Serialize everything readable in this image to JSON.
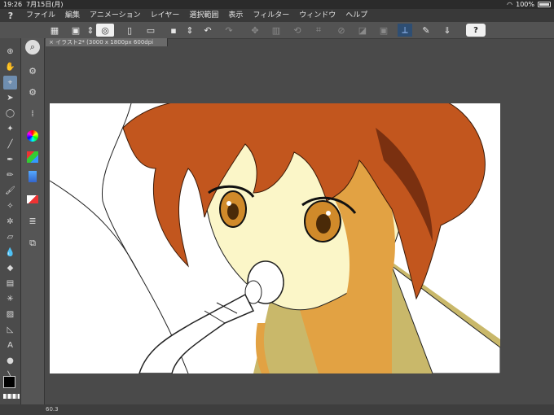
{
  "status_bar": {
    "time": "19:26",
    "date": "7月15日(月)",
    "battery": "100%"
  },
  "menu": {
    "items": [
      "ファイル",
      "編集",
      "アニメーション",
      "レイヤー",
      "選択範囲",
      "表示",
      "フィルター",
      "ウィンドウ",
      "ヘルプ"
    ]
  },
  "document": {
    "tab_title": "イラスト2* (3000 x 1800px 600dpi 60.3%)"
  },
  "statusbar_bottom": {
    "zoom": "60.3"
  },
  "colors": {
    "accent": "#6f8eb0",
    "canvas": "#ffffff",
    "hair": "#c2561e",
    "skin": "#fbf6c8",
    "shadow": "#e2a243"
  }
}
